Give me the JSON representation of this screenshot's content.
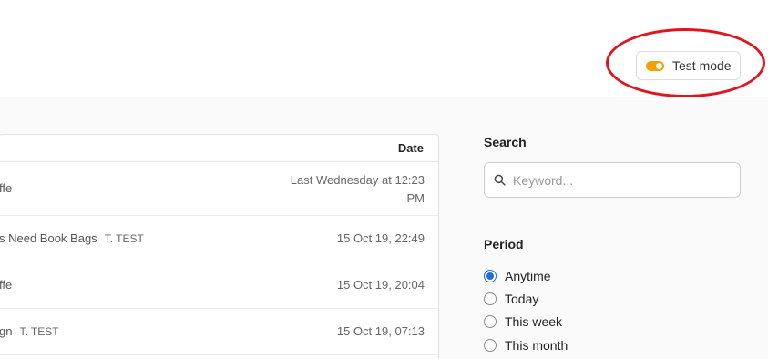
{
  "header": {
    "test_mode_label": "Test mode"
  },
  "table": {
    "date_header": "Date",
    "rows": [
      {
        "text": "ffe",
        "tag": "",
        "date": "Last Wednesday at 12:23 PM"
      },
      {
        "text": "s Need Book Bags",
        "tag": "T. TEST",
        "date": "15 Oct 19, 22:49"
      },
      {
        "text": "ffe",
        "tag": "",
        "date": "15 Oct 19, 20:04"
      },
      {
        "text": "gn",
        "tag": "T. TEST",
        "date": "15 Oct 19, 07:13"
      }
    ]
  },
  "sidebar": {
    "search_heading": "Search",
    "search_placeholder": "Keyword...",
    "period_heading": "Period",
    "period_options": [
      "Anytime",
      "Today",
      "This week",
      "This month"
    ],
    "selected_period": "Anytime"
  },
  "colors": {
    "toggle_accent": "#f2a100",
    "radio_accent": "#1f6fe0",
    "highlight_ring": "#e0141e"
  }
}
